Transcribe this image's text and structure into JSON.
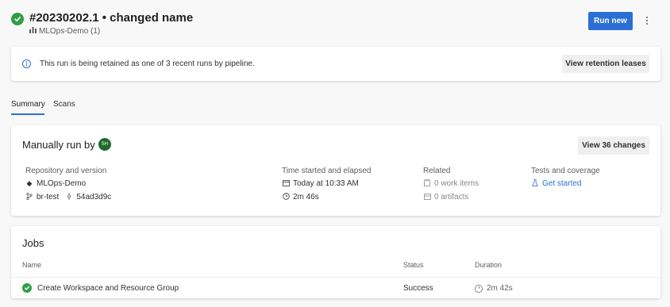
{
  "header": {
    "title": "#20230202.1 • changed name",
    "pipeline": "MLOps-Demo (1)",
    "run_new_label": "Run new"
  },
  "banner": {
    "message": "This run is being retained as one of 3 recent runs by pipeline.",
    "button_label": "View retention leases"
  },
  "tabs": [
    {
      "label": "Summary",
      "active": true
    },
    {
      "label": "Scans",
      "active": false
    }
  ],
  "summary": {
    "heading": "Manually run by",
    "avatar_initials": "SH",
    "view_changes_label": "View 36 changes",
    "repo_label": "Repository and version",
    "repo_name": "MLOps-Demo",
    "branch": "br-test",
    "commit": "54ad3d9c",
    "time_label": "Time started and elapsed",
    "started": "Today at 10:33 AM",
    "elapsed": "2m 46s",
    "related_label": "Related",
    "work_items": "0 work items",
    "artifacts": "0 artifacts",
    "tests_label": "Tests and coverage",
    "get_started": "Get started"
  },
  "jobs": {
    "title": "Jobs",
    "columns": {
      "name": "Name",
      "status": "Status",
      "duration": "Duration"
    },
    "rows": [
      {
        "name": "Create Workspace and Resource Group",
        "status": "Success",
        "duration": "2m 42s"
      }
    ]
  },
  "colors": {
    "accent": "#2b6fd6",
    "success": "#2f9e44",
    "avatar": "#1f6b2d"
  }
}
